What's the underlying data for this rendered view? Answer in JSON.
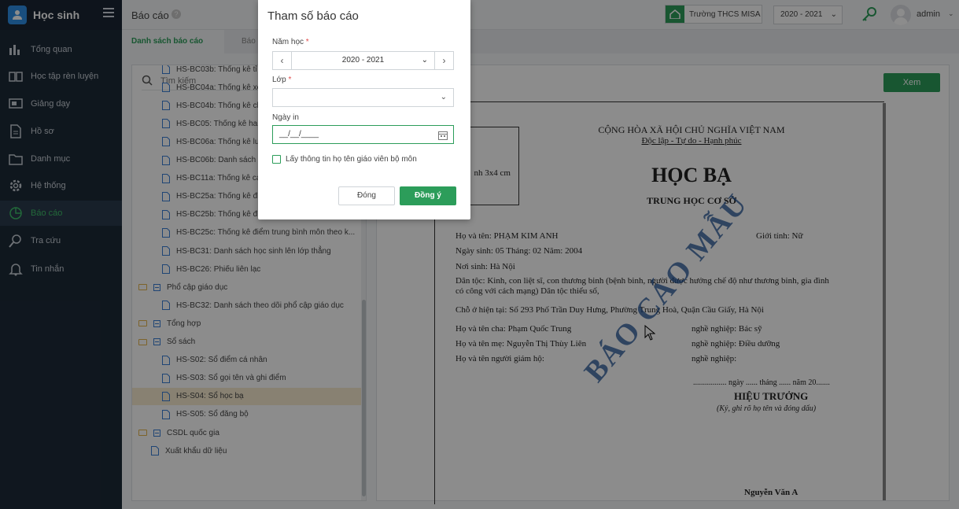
{
  "app": {
    "title": "Học sinh"
  },
  "sidebar": {
    "items": [
      {
        "label": "Tổng quan",
        "icon": "bar-chart-icon"
      },
      {
        "label": "Học tập rèn luyện",
        "icon": "book-icon"
      },
      {
        "label": "Giảng dạy",
        "icon": "board-icon"
      },
      {
        "label": "Hồ sơ",
        "icon": "document-icon"
      },
      {
        "label": "Danh mục",
        "icon": "folder-icon"
      },
      {
        "label": "Hệ thống",
        "icon": "gear-icon"
      },
      {
        "label": "Báo cáo",
        "icon": "pie-chart-icon",
        "active": true
      },
      {
        "label": "Tra cứu",
        "icon": "search-icon"
      },
      {
        "label": "Tin nhắn",
        "icon": "bell-icon"
      }
    ]
  },
  "header": {
    "title": "Báo cáo",
    "help": "?",
    "school": "Trường THCS MISA",
    "year": "2020 - 2021",
    "user": "admin"
  },
  "tabs": {
    "active": "Danh sách báo cáo",
    "other": "Báo"
  },
  "tree": {
    "search_placeholder": "Tìm kiếm",
    "items": [
      {
        "type": "file",
        "label": "HS-BC03b: Thống kê tỉ lệ",
        "indent": 2
      },
      {
        "type": "file",
        "label": "HS-BC04a: Thống kê xếp",
        "indent": 2
      },
      {
        "type": "file",
        "label": "HS-BC04b: Thống kê ch",
        "indent": 2
      },
      {
        "type": "file",
        "label": "HS-BC05: Thống kê hai",
        "indent": 2
      },
      {
        "type": "file",
        "label": "HS-BC06a: Thống kê lư",
        "indent": 2
      },
      {
        "type": "file",
        "label": "HS-BC06b: Danh sách h",
        "indent": 2
      },
      {
        "type": "file",
        "label": "HS-BC11a: Thống kê cá",
        "indent": 2
      },
      {
        "type": "file",
        "label": "HS-BC25a: Thống kê điểm thi giữa kỳ theo khoả...",
        "indent": 2
      },
      {
        "type": "file",
        "label": "HS-BC25b: Thống kê điểm thi cuối kỳ theo khoả...",
        "indent": 2
      },
      {
        "type": "file",
        "label": "HS-BC25c: Thống kê điểm trung bình môn theo k...",
        "indent": 2
      },
      {
        "type": "file",
        "label": "HS-BC31: Danh sách học sinh lên lớp thẳng",
        "indent": 2
      },
      {
        "type": "file",
        "label": "HS-BC26: Phiếu liên lạc",
        "indent": 2
      },
      {
        "type": "folder",
        "label": "Phổ cập giáo dục",
        "indent": 0
      },
      {
        "type": "file",
        "label": "HS-BC32: Danh sách theo dõi phổ cập giáo dục",
        "indent": 2
      },
      {
        "type": "folder",
        "label": "Tổng hợp",
        "indent": 0
      },
      {
        "type": "folder",
        "label": "Sổ sách",
        "indent": 0
      },
      {
        "type": "file",
        "label": "HS-S02: Sổ điểm cá nhân",
        "indent": 2
      },
      {
        "type": "file",
        "label": "HS-S03: Sổ gọi tên và ghi điểm",
        "indent": 2
      },
      {
        "type": "file",
        "label": "HS-S04: Sổ học bạ",
        "indent": 2,
        "selected": true
      },
      {
        "type": "file",
        "label": "HS-S05: Sổ đăng bộ",
        "indent": 2
      },
      {
        "type": "folder",
        "label": "CSDL quốc gia",
        "indent": 0
      },
      {
        "type": "file",
        "label": "Xuất khẩu dữ liệu",
        "indent": 1
      }
    ]
  },
  "preview": {
    "view_button": "Xem",
    "photo": "nh 3x4 cm",
    "nation": "CỘNG HÒA XÃ HỘI CHỦ NGHĨA VIỆT NAM",
    "motto": "Độc lập - Tự do - Hạnh phúc",
    "doc_title": "HỌC BẠ",
    "doc_subtitle": "TRUNG HỌC CƠ SỞ",
    "name_line": "Họ và tên:  PHẠM KIM ANH",
    "gender_line": "Giới tính:  Nữ",
    "dob_line": "Ngày sinh:  05    Tháng:  02    Năm:  2004",
    "pob_line": "Nơi sinh:  Hà Nội",
    "ethnic_line1": "Dân tộc: Kinh, con liệt sĩ, con thương binh (bệnh binh, người được hưởng chế độ như thương binh, gia đình",
    "ethnic_line2": "có công với cách mạng) Dân tộc thiểu số,",
    "address_line": "Chỗ ở hiện tại:   Số 293 Phố Trần Duy Hưng, Phường Trung Hoà, Quận Cầu Giấy, Hà Nội",
    "father_line": "Họ và tên cha:    Phạm Quốc Trung",
    "father_job": "nghề nghiệp:      Bác sỹ",
    "mother_line": "Họ và tên mẹ:    Nguyễn Thị Thùy Liên",
    "mother_job": "nghề nghiệp:      Điều dưỡng",
    "guardian_line": "Họ và tên người giám hộ:",
    "guardian_job": "nghề nghiệp:",
    "date_line": "................. ngày ...... tháng ...... năm 20.......",
    "principal": "HIỆU TRƯỞNG",
    "sign_note": "(Ký, ghi rõ họ tên và đóng dấu)",
    "signer": "Nguyễn Văn A",
    "watermark": "BÁO CÁO MẪU"
  },
  "dialog": {
    "title": "Tham số báo cáo",
    "year_label": "Năm học",
    "year_value": "2020 - 2021",
    "class_label": "Lớp",
    "class_value": "",
    "date_label": "Ngày in",
    "date_value": "__/__/____",
    "checkbox_label": "Lấy thông tin họ tên giáo viên bộ môn",
    "required_mark": "*",
    "close_label": "Đóng",
    "ok_label": "Đồng ý"
  },
  "colors": {
    "accent": "#2c9d5a",
    "sidebar": "#1d2a38",
    "selected_row": "#f7ecd0"
  }
}
